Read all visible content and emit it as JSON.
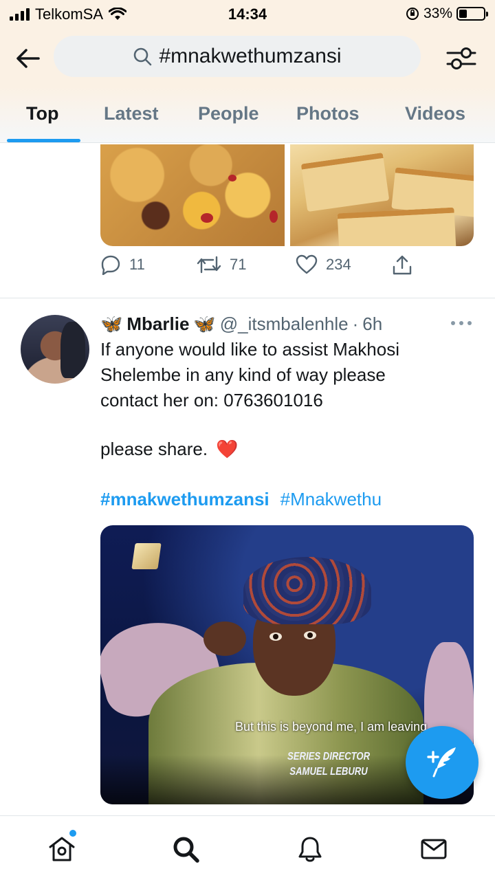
{
  "status_bar": {
    "carrier": "TelkomSA",
    "time": "14:34",
    "battery_percent": "33%",
    "battery_level": 0.33
  },
  "search": {
    "query": "#mnakwethumzansi"
  },
  "tabs": [
    {
      "label": "Top",
      "active": true
    },
    {
      "label": "Latest",
      "active": false
    },
    {
      "label": "People",
      "active": false
    },
    {
      "label": "Photos",
      "active": false
    },
    {
      "label": "Videos",
      "active": false
    }
  ],
  "tweet1": {
    "replies": "11",
    "retweets": "71",
    "likes": "234"
  },
  "tweet2": {
    "display_name": "Mbarlie",
    "handle": "@_itsmbalenhle",
    "separator": "·",
    "time_ago": "6h",
    "text_lines": [
      "If anyone would like to assist Makhosi",
      "Shelembe in any kind of way please",
      "contact her on: 0763601016"
    ],
    "share_text": "please share.",
    "share_emoji": "❤️",
    "hashtags": [
      "#mnakwethumzansi",
      "#Mnakwethu"
    ],
    "video": {
      "subtitle": "But this is beyond me, I am leaving",
      "credit_title": "SERIES DIRECTOR",
      "credit_name": "SAMUEL LEBURU"
    }
  },
  "icons": {
    "butterfly": "🦋"
  },
  "colors": {
    "accent": "#1d9bf0",
    "header_bg": "#fbf1e4",
    "muted_text": "#536471"
  }
}
